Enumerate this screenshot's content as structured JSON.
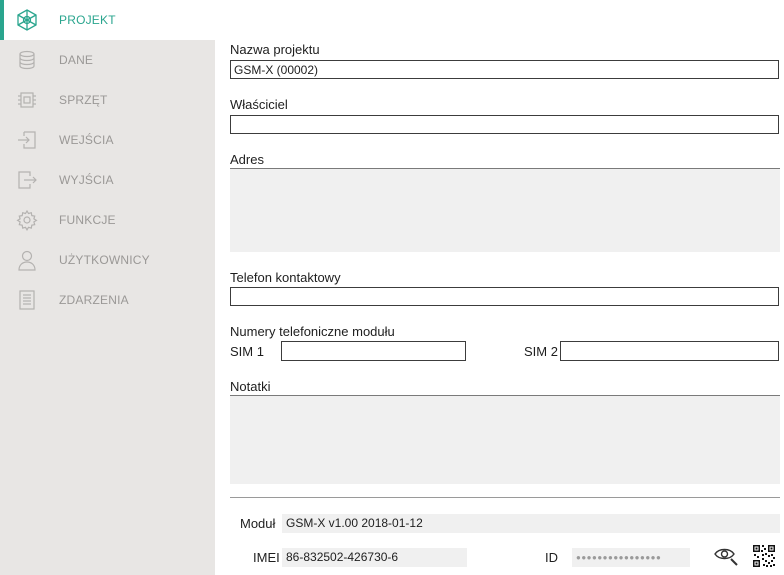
{
  "sidebar": {
    "accent_color": "#2aa58e",
    "items": [
      {
        "label": "PROJEKT",
        "icon": "project-icon",
        "active": true
      },
      {
        "label": "DANE",
        "icon": "database-icon"
      },
      {
        "label": "SPRZĘT",
        "icon": "chip-icon"
      },
      {
        "label": "WEJŚCIA",
        "icon": "input-icon"
      },
      {
        "label": "WYJŚCIA",
        "icon": "output-icon"
      },
      {
        "label": "FUNKCJE",
        "icon": "gear-icon"
      },
      {
        "label": "UŻYTKOWNICY",
        "icon": "user-icon"
      },
      {
        "label": "ZDARZENIA",
        "icon": "list-icon"
      }
    ]
  },
  "form": {
    "project_name_label": "Nazwa projektu",
    "project_name_value": "GSM-X (00002)",
    "owner_label": "Właściciel",
    "owner_value": "",
    "address_label": "Adres",
    "address_value": "",
    "contact_phone_label": "Telefon kontaktowy",
    "contact_phone_value": "",
    "module_phones_label": "Numery telefoniczne modułu",
    "sim1_label": "SIM 1",
    "sim1_value": "",
    "sim2_label": "SIM 2",
    "sim2_value": "",
    "notes_label": "Notatki",
    "notes_value": ""
  },
  "module_info": {
    "module_label": "Moduł",
    "module_value": "GSM-X v1.00 2018-01-12",
    "imei_label": "IMEI",
    "imei_value": "86-832502-426730-6",
    "id_label": "ID",
    "id_value": "●●●●●●●●●●●●●●●●",
    "show_id_icon": "eye-icon",
    "qr_icon": "qr-code-icon"
  }
}
